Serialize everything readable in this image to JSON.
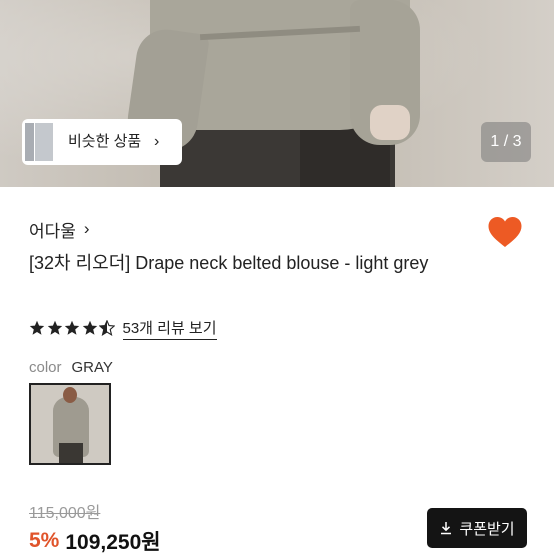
{
  "hero": {
    "similar_label": "비슷한 상품",
    "counter": "1 / 3"
  },
  "product": {
    "brand": "어다울",
    "title": "[32차 리오더] Drape neck belted blouse - light grey",
    "rating": 4.5,
    "reviews_link": "53개 리뷰 보기",
    "color_label": "color",
    "color_value": "GRAY",
    "original_price": "115,000원",
    "discount": "5%",
    "sale_price": "109,250원",
    "coupon_label": "쿠폰받기"
  },
  "colors": {
    "heart": "#ed5a24",
    "discount": "#e0542b",
    "coupon_bg": "#141414"
  },
  "icons": {
    "similar": "chevron-right-icon",
    "brand": "chevron-right-icon",
    "favorite": "heart-icon",
    "coupon": "download-icon"
  }
}
